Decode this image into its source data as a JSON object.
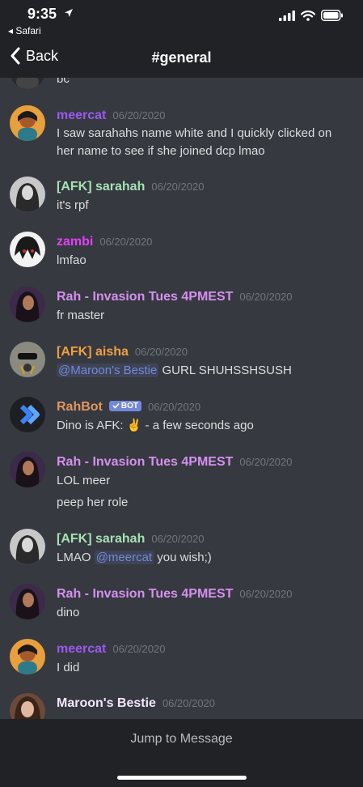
{
  "status": {
    "time": "9:35",
    "back_app": "◂ Safari"
  },
  "nav": {
    "back_label": "Back",
    "title": "#general"
  },
  "partial_top_text": "bc",
  "messages": [
    {
      "username": "meercat",
      "timestamp": "06/20/2020",
      "color": "#9b59f0",
      "lines": [
        "I saw sarahahs name white and I quickly clicked on",
        "her name to see if she joined dcp lmao"
      ]
    },
    {
      "username": "[AFK] sarahah",
      "timestamp": "06/20/2020",
      "color": "#a8e0b5",
      "lines": [
        "it's rpf"
      ]
    },
    {
      "username": "zambi",
      "timestamp": "06/20/2020",
      "color": "#e040fb",
      "lines": [
        "lmfao"
      ]
    },
    {
      "username": "Rah - Invasion Tues 4PMEST",
      "timestamp": "06/20/2020",
      "color": "#d68ff0",
      "lines": [
        "fr master"
      ]
    },
    {
      "username": "[AFK] aisha",
      "timestamp": "06/20/2020",
      "color": "#f0a040",
      "mention": "@Maroon's Bestie",
      "text_after_mention": " GURL SHUHSSHSUSH"
    },
    {
      "username": "RahBot",
      "timestamp": "06/20/2020",
      "color": "#e09660",
      "bot_badge": "BOT",
      "lines": [
        "Dino is AFK: ✌️  - a few seconds ago"
      ]
    },
    {
      "username": "Rah - Invasion Tues 4PMEST",
      "timestamp": "06/20/2020",
      "color": "#d68ff0",
      "lines": [
        "LOL meer",
        "peep her role"
      ]
    },
    {
      "username": "[AFK] sarahah",
      "timestamp": "06/20/2020",
      "color": "#a8e0b5",
      "text_before_mention": "LMAO ",
      "mention": "@meercat",
      "text_after_mention": " you wish;)"
    },
    {
      "username": "Rah - Invasion Tues 4PMEST",
      "timestamp": "06/20/2020",
      "color": "#d68ff0",
      "lines": [
        "dino"
      ]
    },
    {
      "username": "meercat",
      "timestamp": "06/20/2020",
      "color": "#9b59f0",
      "lines": [
        "I did"
      ]
    },
    {
      "username": "Maroon's Bestie",
      "timestamp": "06/20/2020",
      "color": "#f5e6ff"
    }
  ],
  "jump_bar": {
    "label": "Jump to Message"
  },
  "icons": [
    "location-arrow-icon",
    "signal-icon",
    "wifi-icon",
    "battery-icon",
    "chevron-left-icon",
    "verified-check-icon"
  ]
}
